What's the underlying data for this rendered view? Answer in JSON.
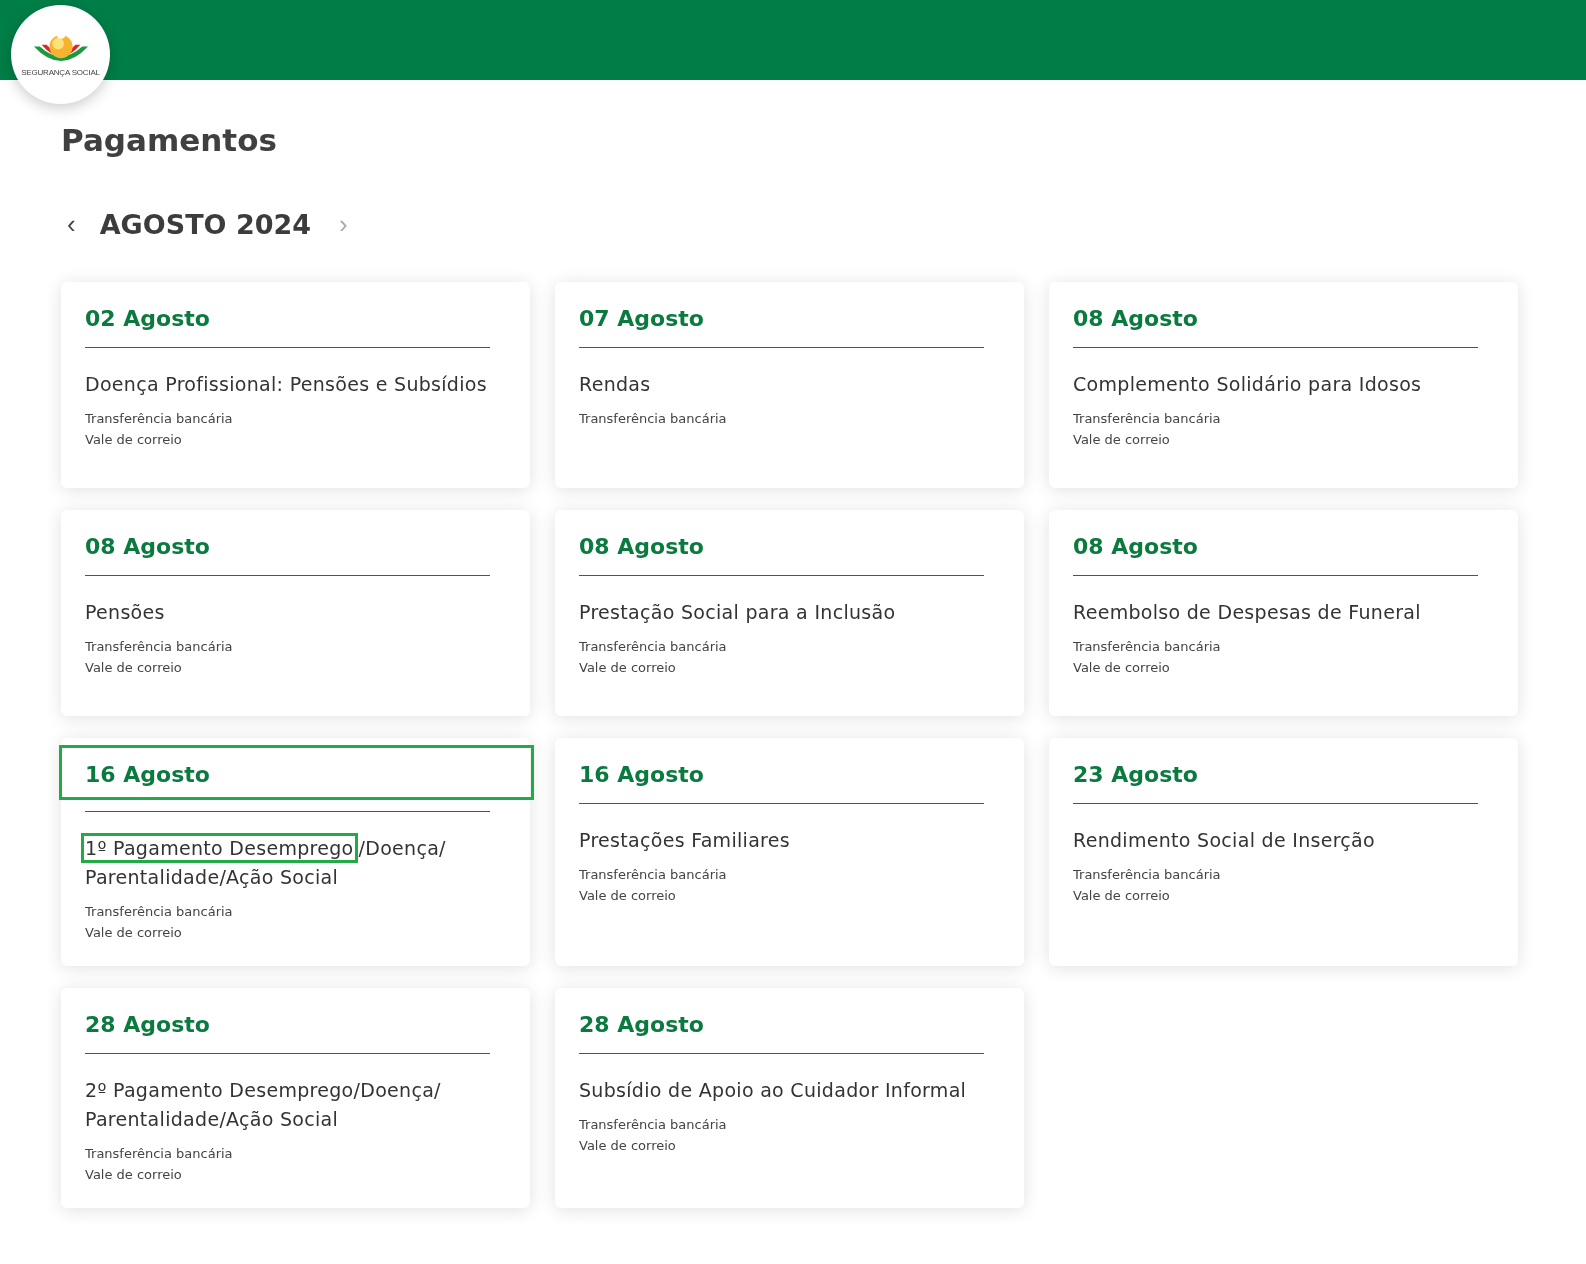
{
  "header": {
    "logo_text": "SEGURANÇA SOCIAL"
  },
  "page_title": "Pagamentos",
  "month_nav": {
    "prev": "‹",
    "label": "AGOSTO 2024",
    "next": "›"
  },
  "payments": [
    {
      "date": "02 Agosto",
      "date_highlighted": false,
      "title": "Doença Profissional: Pensões e Subsídios",
      "methods": [
        "Transferência bancária",
        "Vale de correio"
      ]
    },
    {
      "date": "07 Agosto",
      "date_highlighted": false,
      "title": "Rendas",
      "methods": [
        "Transferência bancária"
      ]
    },
    {
      "date": "08 Agosto",
      "date_highlighted": false,
      "title": "Complemento Solidário para Idosos",
      "methods": [
        "Transferência bancária",
        "Vale de correio"
      ]
    },
    {
      "date": "08 Agosto",
      "date_highlighted": false,
      "title": "Pensões",
      "methods": [
        "Transferência bancária",
        "Vale de correio"
      ]
    },
    {
      "date": "08 Agosto",
      "date_highlighted": false,
      "title": "Prestação Social para a Inclusão",
      "methods": [
        "Transferência bancária",
        "Vale de correio"
      ]
    },
    {
      "date": "08 Agosto",
      "date_highlighted": false,
      "title": "Reembolso de Despesas de Funeral",
      "methods": [
        "Transferência bancária",
        "Vale de correio"
      ]
    },
    {
      "date": "16 Agosto",
      "date_highlighted": true,
      "title_parts": [
        {
          "text": "1º Pagamento Desemprego",
          "highlighted": true
        },
        {
          "text": "/Doença/ Parentalidade/Ação Social",
          "highlighted": false
        }
      ],
      "methods": [
        "Transferência bancária",
        "Vale de correio"
      ]
    },
    {
      "date": "16 Agosto",
      "date_highlighted": false,
      "title": "Prestações Familiares",
      "methods": [
        "Transferência bancária",
        "Vale de correio"
      ]
    },
    {
      "date": "23 Agosto",
      "date_highlighted": false,
      "title": "Rendimento Social de Inserção",
      "methods": [
        "Transferência bancária",
        "Vale de correio"
      ]
    },
    {
      "date": "28 Agosto",
      "date_highlighted": false,
      "title": "2º Pagamento Desemprego/Doença/ Parentalidade/Ação Social",
      "methods": [
        "Transferência bancária",
        "Vale de correio"
      ]
    },
    {
      "date": "28 Agosto",
      "date_highlighted": false,
      "title": "Subsídio de Apoio ao Cuidador Informal",
      "methods": [
        "Transferência bancária",
        "Vale de correio"
      ]
    }
  ]
}
